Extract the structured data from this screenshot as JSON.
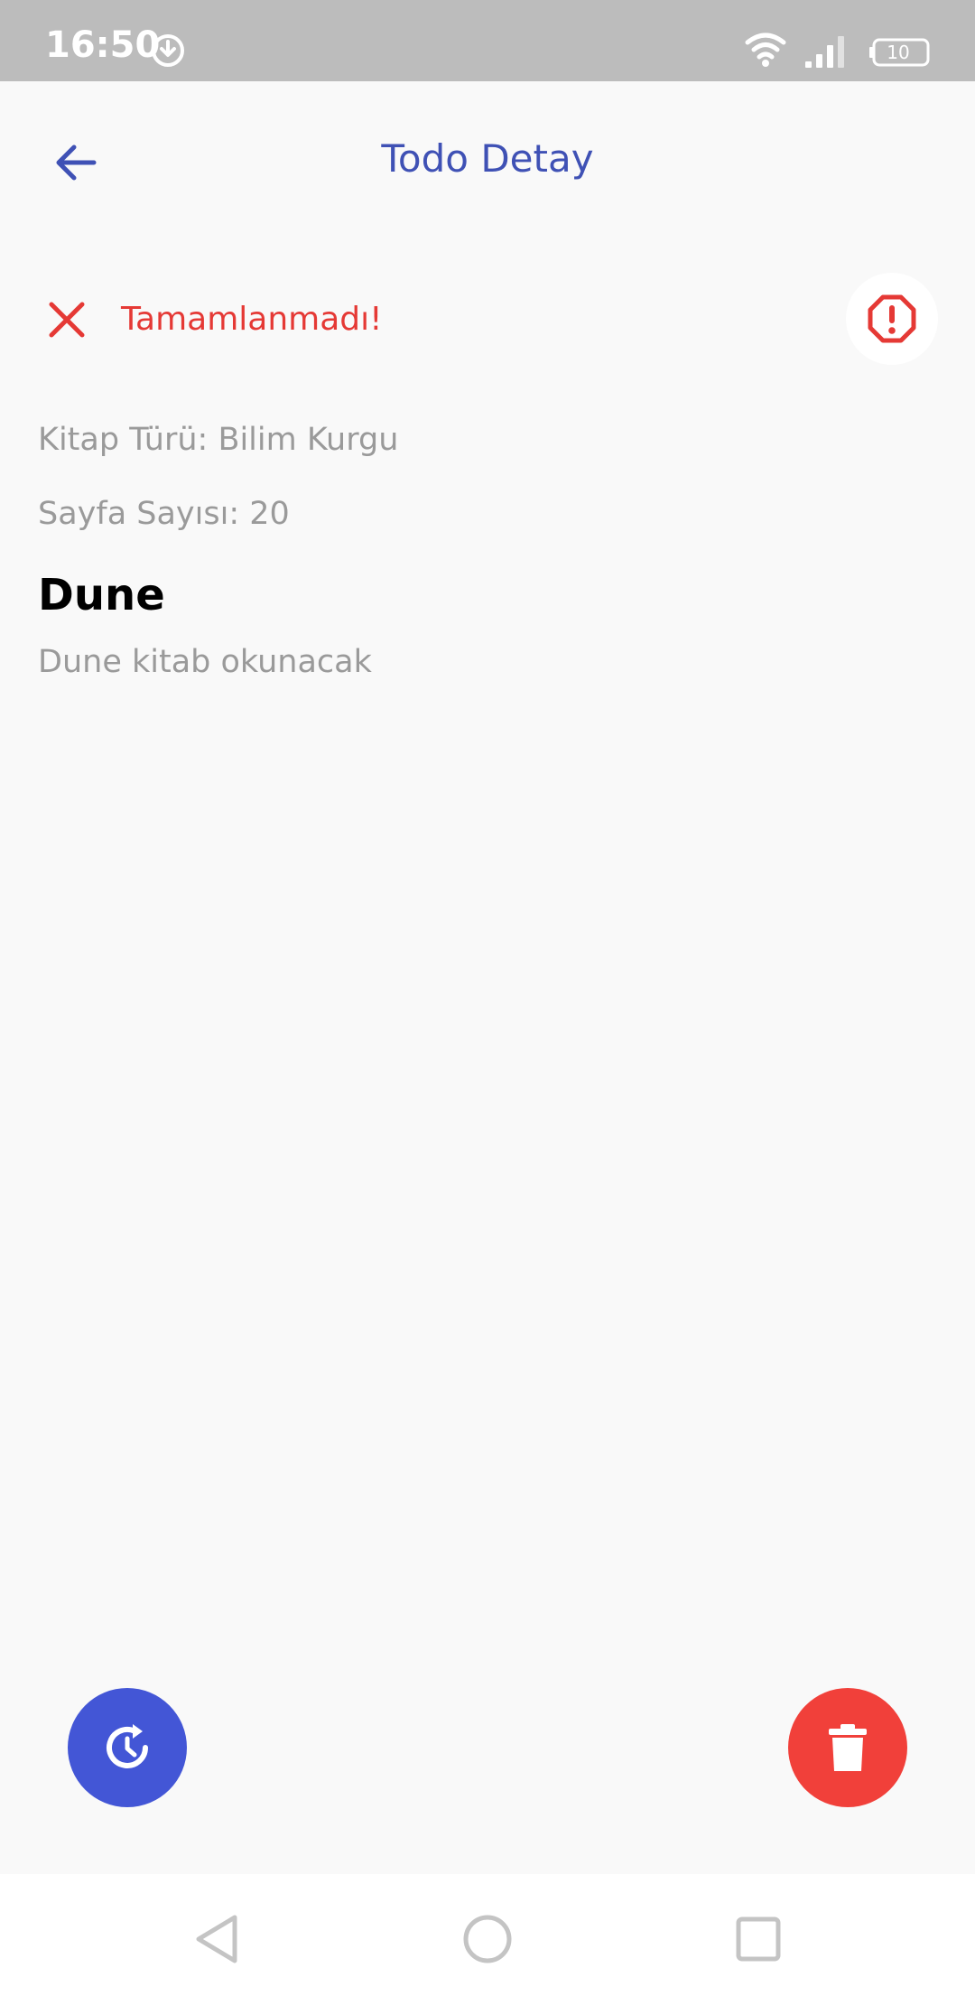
{
  "status_bar": {
    "time": "16:50",
    "battery_level": "10",
    "icons": [
      "download-icon",
      "wifi-icon",
      "signal-icon",
      "battery-icon"
    ]
  },
  "app_bar": {
    "title": "Todo Detay",
    "back_icon": "arrow-left-icon"
  },
  "todo": {
    "status_text": "Tamamlanmadı!",
    "status_icon": "close-icon",
    "warning_icon": "alert-octagon-icon",
    "book_type": "Kitap Türü: Bilim Kurgu",
    "page_count": "Sayfa Sayısı: 20",
    "title": "Dune",
    "description": "Dune kitab okunacak"
  },
  "actions": {
    "refresh_icon": "restore-icon",
    "delete_icon": "trash-icon"
  },
  "colors": {
    "primary": "#3f51b5",
    "fab_primary": "#4356d6",
    "danger": "#e53935",
    "fab_danger": "#f1403a",
    "status_bar": "#bcbcbc",
    "background": "#f9f9f9"
  },
  "nav_bar": {
    "items": [
      "back-icon",
      "home-icon",
      "recents-icon"
    ]
  }
}
